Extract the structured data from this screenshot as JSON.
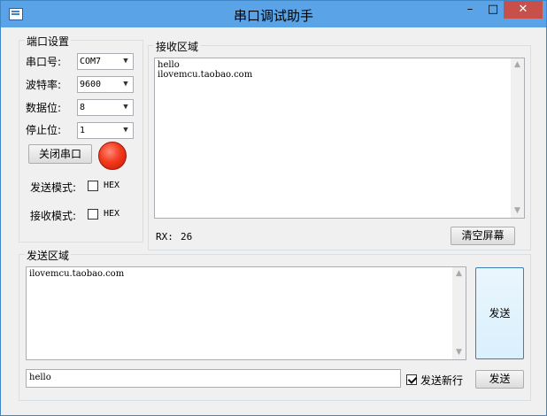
{
  "window": {
    "title": "串口调试助手",
    "min_glyph": "–",
    "max_glyph": "□",
    "close_glyph": "✕"
  },
  "port_settings": {
    "group_title": "端口设置",
    "port_label": "串口号:",
    "port_value": "COM7",
    "baud_label": "波特率:",
    "baud_value": "9600",
    "databits_label": "数据位:",
    "databits_value": "8",
    "stopbits_label": "停止位:",
    "stopbits_value": "1",
    "close_port_button": "关闭串口",
    "port_status_color": "#f43a1c",
    "send_mode_label": "发送模式:",
    "send_mode_hex_label": "HEX",
    "send_mode_hex_checked": false,
    "recv_mode_label": "接收模式:",
    "recv_mode_hex_label": "HEX",
    "recv_mode_hex_checked": false
  },
  "receive": {
    "group_title": "接收区域",
    "lines": [
      "hello",
      "ilovemcu.taobao.com"
    ],
    "rx_label": "RX:",
    "rx_count": "26",
    "clear_button": "清空屏幕"
  },
  "send": {
    "group_title": "发送区域",
    "text": "ilovemcu.taobao.com",
    "send_button_large": "发送",
    "line_input": "hello",
    "newline_label": "发送新行",
    "newline_checked": true,
    "send_button_small": "发送"
  },
  "dropdown_arrow": "▼",
  "scroll_up_glyph": "▲",
  "scroll_down_glyph": "▼"
}
